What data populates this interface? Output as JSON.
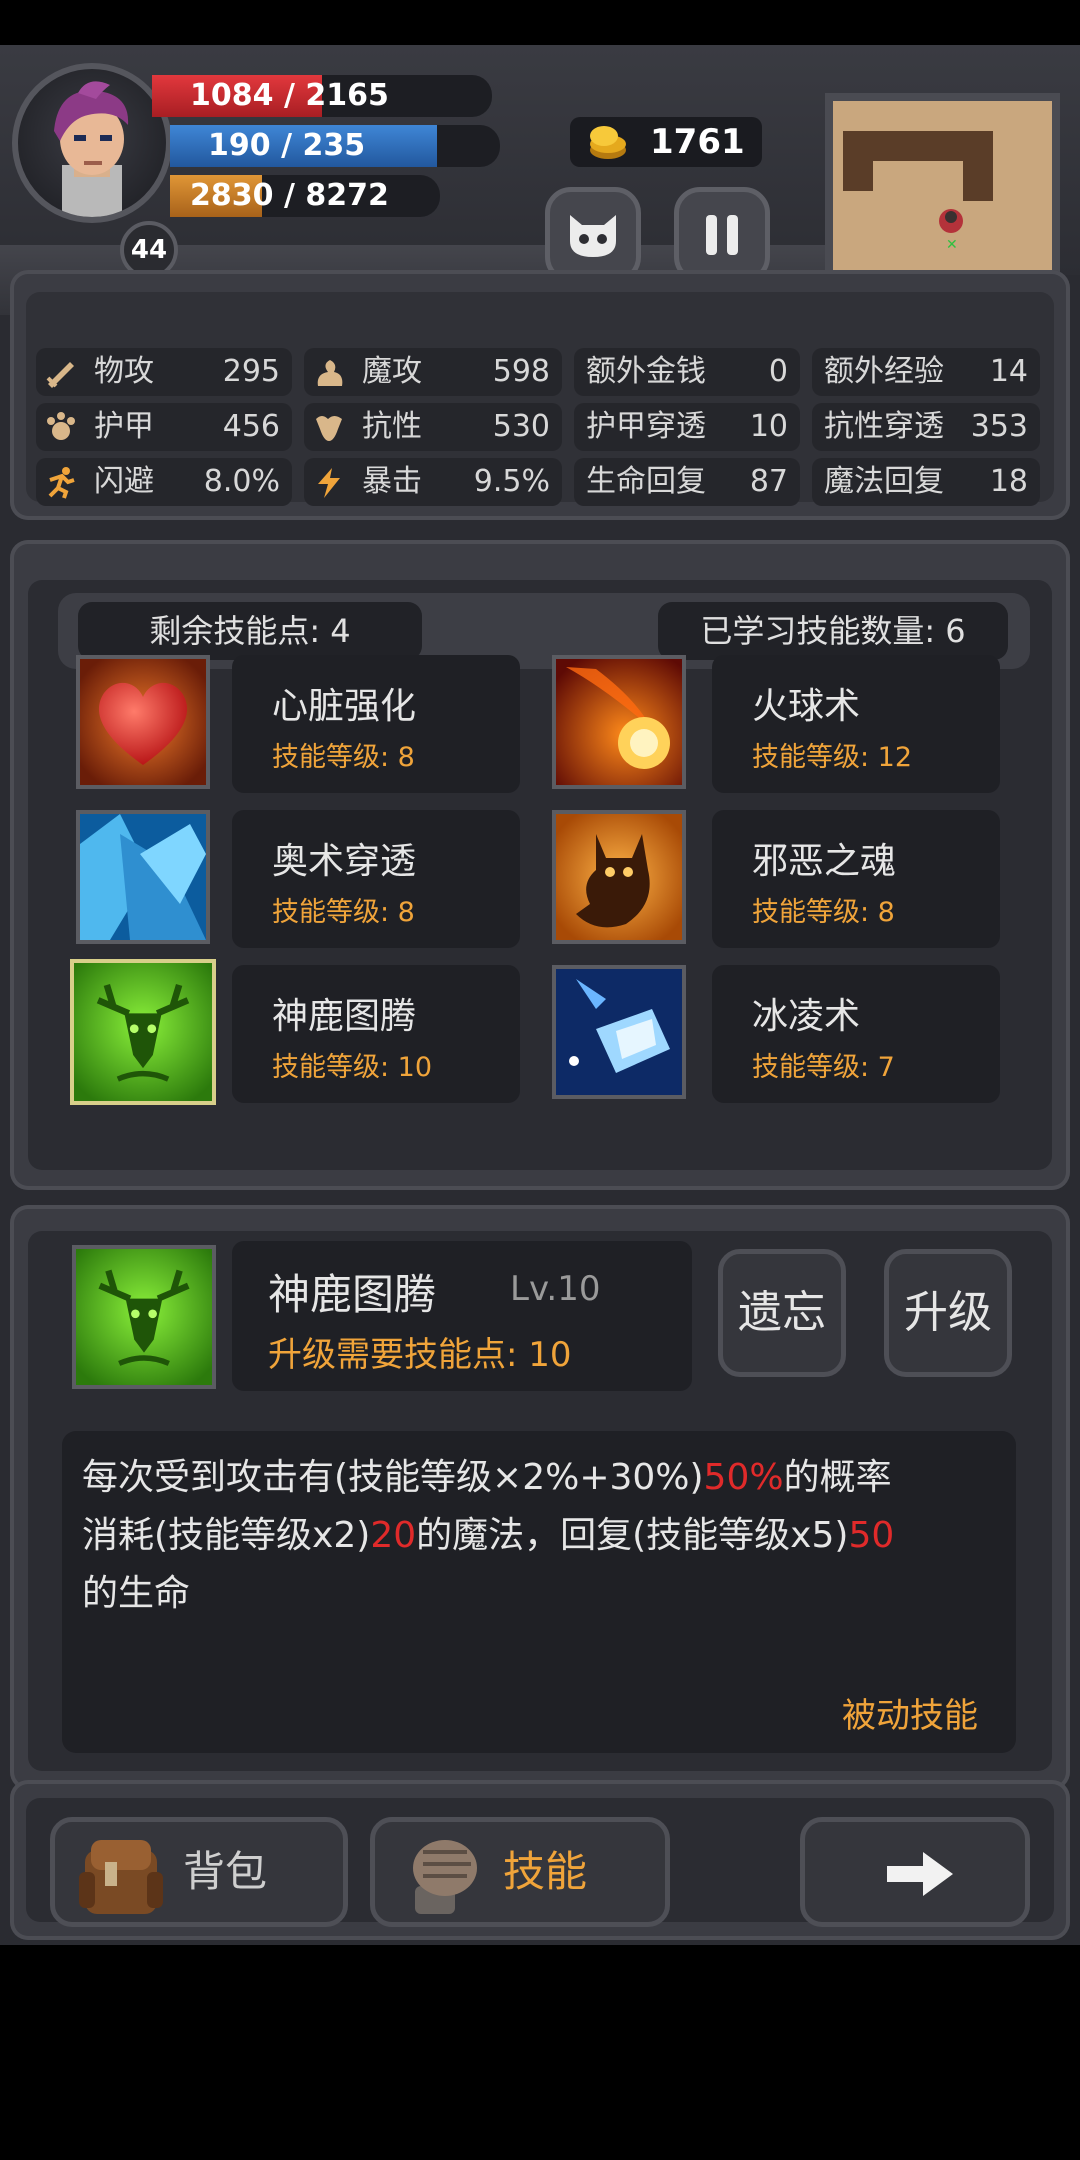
{
  "hud": {
    "hp": "1084 / 2165",
    "hp_fraction": 0.5007,
    "mp": "190 / 235",
    "mp_fraction": 0.8085,
    "xp": "2830 / 8272",
    "xp_fraction": 0.342,
    "level": "44",
    "coins": "1761",
    "colors": {
      "hp": "#c4262b",
      "mp": "#2e6bb3",
      "xp": "#c87a20"
    }
  },
  "stats": [
    {
      "label": "物攻",
      "value": "295",
      "icon": "sword-icon"
    },
    {
      "label": "魔攻",
      "value": "598",
      "icon": "genie-icon"
    },
    {
      "label": "额外金钱",
      "value": "0",
      "icon": ""
    },
    {
      "label": "额外经验",
      "value": "14",
      "icon": ""
    },
    {
      "label": "护甲",
      "value": "456",
      "icon": "paw-shield-icon"
    },
    {
      "label": "抗性",
      "value": "530",
      "icon": "flex-arm-icon"
    },
    {
      "label": "护甲穿透",
      "value": "10",
      "icon": ""
    },
    {
      "label": "抗性穿透",
      "value": "353",
      "icon": ""
    },
    {
      "label": "闪避",
      "value": "8.0%",
      "icon": "running-man-icon"
    },
    {
      "label": "暴击",
      "value": "9.5%",
      "icon": "lightning-icon"
    },
    {
      "label": "生命回复",
      "value": "87",
      "icon": ""
    },
    {
      "label": "魔法回复",
      "value": "18",
      "icon": ""
    }
  ],
  "skills_panel": {
    "remaining_points": "剩余技能点: 4",
    "learned_count": "已学习技能数量: 6",
    "skills": [
      {
        "name": "心脏强化",
        "level": "技能等级: 8",
        "icon": "heart-icon"
      },
      {
        "name": "火球术",
        "level": "技能等级: 12",
        "icon": "fireball-icon"
      },
      {
        "name": "奥术穿透",
        "level": "技能等级: 8",
        "icon": "ice-shard-icon"
      },
      {
        "name": "邪恶之魂",
        "level": "技能等级: 8",
        "icon": "demon-soul-icon"
      },
      {
        "name": "神鹿图腾",
        "level": "技能等级: 10",
        "icon": "deer-totem-icon"
      },
      {
        "name": "冰凌术",
        "level": "技能等级: 7",
        "icon": "ice-crystal-icon"
      }
    ]
  },
  "detail": {
    "name": "神鹿图腾",
    "level": "Lv.10",
    "cost": "升级需要技能点: 10",
    "forget_label": "遗忘",
    "upgrade_label": "升级",
    "desc_1": "每次受到攻击有(技能等级×2%+30%)",
    "desc_1_value": "50%",
    "desc_1_tail": "的概率",
    "desc_2": "消耗(技能等级x2)",
    "desc_2_value": "20",
    "desc_2_mid": "的魔法，回复(技能等级x5)",
    "desc_2_value2": "50",
    "desc_3": "的生命",
    "type": "被动技能"
  },
  "bottom_bar": {
    "bag_label": "背包",
    "skill_label": "技能"
  }
}
